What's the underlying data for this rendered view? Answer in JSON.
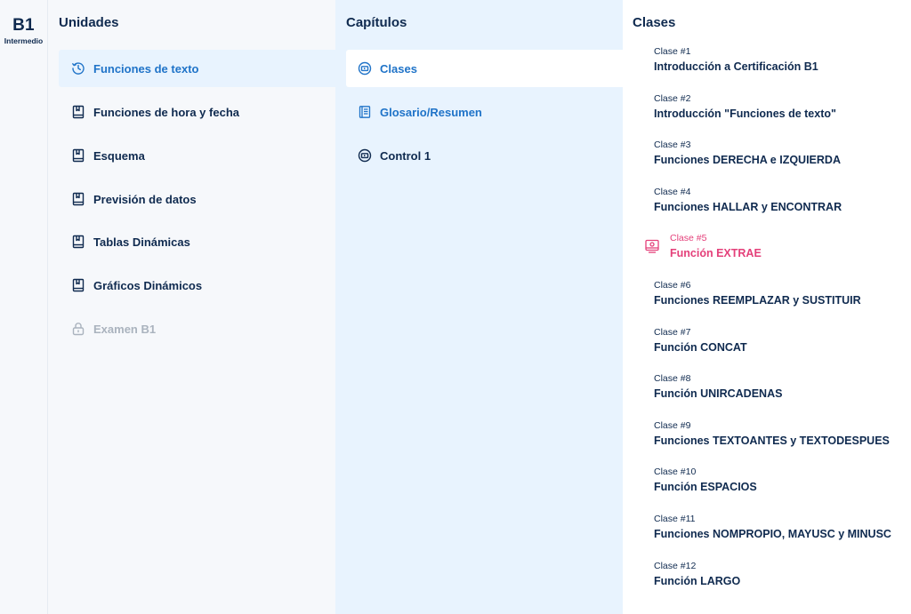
{
  "level": {
    "code": "B1",
    "name": "Intermedio"
  },
  "units": {
    "title": "Unidades",
    "items": [
      {
        "label": "Funciones de texto",
        "icon": "clock-history-icon",
        "state": "active"
      },
      {
        "label": "Funciones de hora y fecha",
        "icon": "book-icon",
        "state": "default"
      },
      {
        "label": "Esquema",
        "icon": "book-icon",
        "state": "default"
      },
      {
        "label": "Previsión de datos",
        "icon": "book-icon",
        "state": "default"
      },
      {
        "label": "Tablas Dinámicas",
        "icon": "book-icon",
        "state": "default"
      },
      {
        "label": "Gráficos Dinámicos",
        "icon": "book-icon",
        "state": "default"
      },
      {
        "label": "Examen B1",
        "icon": "lock-icon",
        "state": "locked"
      }
    ]
  },
  "chapters": {
    "title": "Capítulos",
    "items": [
      {
        "label": "Clases",
        "icon": "video-icon",
        "state": "active"
      },
      {
        "label": "Glosario/Resumen",
        "icon": "notebook-icon",
        "state": "default"
      },
      {
        "label": "Control 1",
        "icon": "video-icon",
        "state": "default"
      }
    ]
  },
  "classes": {
    "title": "Clases",
    "items": [
      {
        "number": "Clase #1",
        "name": "Introducción a Certificación B1"
      },
      {
        "number": "Clase #2",
        "name": "Introducción \"Funciones de texto\""
      },
      {
        "number": "Clase #3",
        "name": "Funciones DERECHA e IZQUIERDA"
      },
      {
        "number": "Clase #4",
        "name": "Funciones HALLAR y ENCONTRAR"
      },
      {
        "number": "Clase #5",
        "name": "Función EXTRAE",
        "current": true
      },
      {
        "number": "Clase #6",
        "name": "Funciones REEMPLAZAR y SUSTITUIR"
      },
      {
        "number": "Clase #7",
        "name": "Función CONCAT"
      },
      {
        "number": "Clase #8",
        "name": "Función UNIRCADENAS"
      },
      {
        "number": "Clase #9",
        "name": "Funciones TEXTOANTES y TEXTODESPUES"
      },
      {
        "number": "Clase #10",
        "name": "Función ESPACIOS"
      },
      {
        "number": "Clase #11",
        "name": "Funciones NOMPROPIO, MAYUSC y MINUSC"
      },
      {
        "number": "Clase #12",
        "name": "Función LARGO"
      }
    ]
  },
  "colors": {
    "navy": "#0f2a4f",
    "accent_blue": "#1f73c8",
    "current_pink": "#e4407a",
    "locked_gray": "#aab3be"
  }
}
